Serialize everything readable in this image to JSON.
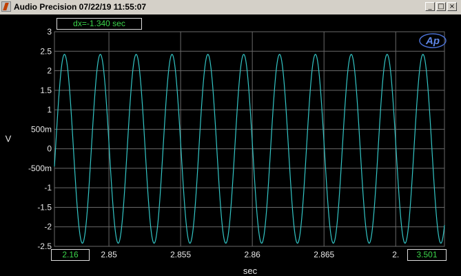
{
  "window": {
    "title": "Audio Precision  07/22/19 11:55:07",
    "buttons": {
      "minimize": "_",
      "maximize": "□",
      "close": "×"
    }
  },
  "plot": {
    "dx_readout": "dx=-1.340  sec",
    "left_cursor": "2.16",
    "right_cursor": "3.501",
    "logo": "Ap",
    "y_unit": "V",
    "x_unit": "sec"
  },
  "colors": {
    "trace": "#33c6c6",
    "grid": "#6a6a6a",
    "cursor_text": "#3bd54a",
    "axis_text": "#e8e8e8"
  },
  "chart_data": {
    "type": "line",
    "title": "",
    "xlabel": "sec",
    "ylabel": "V",
    "xlim": [
      2.8462,
      2.8734
    ],
    "ylim": [
      -2.5,
      3
    ],
    "grid": true,
    "x_ticks": [
      2.85,
      2.855,
      2.86,
      2.865,
      2.87
    ],
    "x_tick_labels": [
      "2.85",
      "2.855",
      "2.86",
      "2.865",
      "2."
    ],
    "y_ticks": [
      3,
      2.5,
      2,
      1.5,
      1,
      0.5,
      0,
      -0.5,
      -1,
      -1.5,
      -2,
      -2.5
    ],
    "y_tick_labels": [
      "3",
      "2.5",
      "2",
      "1.5",
      "1",
      "500m",
      "0",
      "-500m",
      "-1",
      "-1.5",
      "-2",
      "-2.5"
    ],
    "series": [
      {
        "type": "sine",
        "amplitude": 2.42,
        "frequency_hz": 400,
        "peak_at": 2.8469
      }
    ]
  }
}
